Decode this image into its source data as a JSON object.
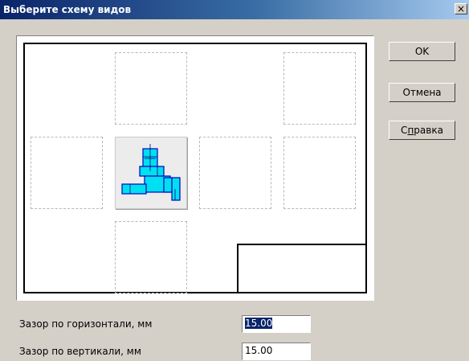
{
  "window": {
    "title": "Выберите схему видов",
    "close_glyph": "×"
  },
  "buttons": {
    "ok": "OK",
    "cancel": "Отмена",
    "help_prefix": "С",
    "help_accel": "п",
    "help_suffix": "равка"
  },
  "fields": {
    "horizontal_gap": {
      "label": "Зазор по горизонтали, мм",
      "value": "15.00"
    },
    "vertical_gap": {
      "label": "Зазор по вертикали, мм",
      "value": "15.00"
    }
  },
  "scheme": {
    "selected_slot": "center-left",
    "part_icon": "bracket-part-icon",
    "colors": {
      "part_fill": "#00e0f0",
      "part_outline": "#0000c0",
      "selection": "#0a246a"
    }
  }
}
